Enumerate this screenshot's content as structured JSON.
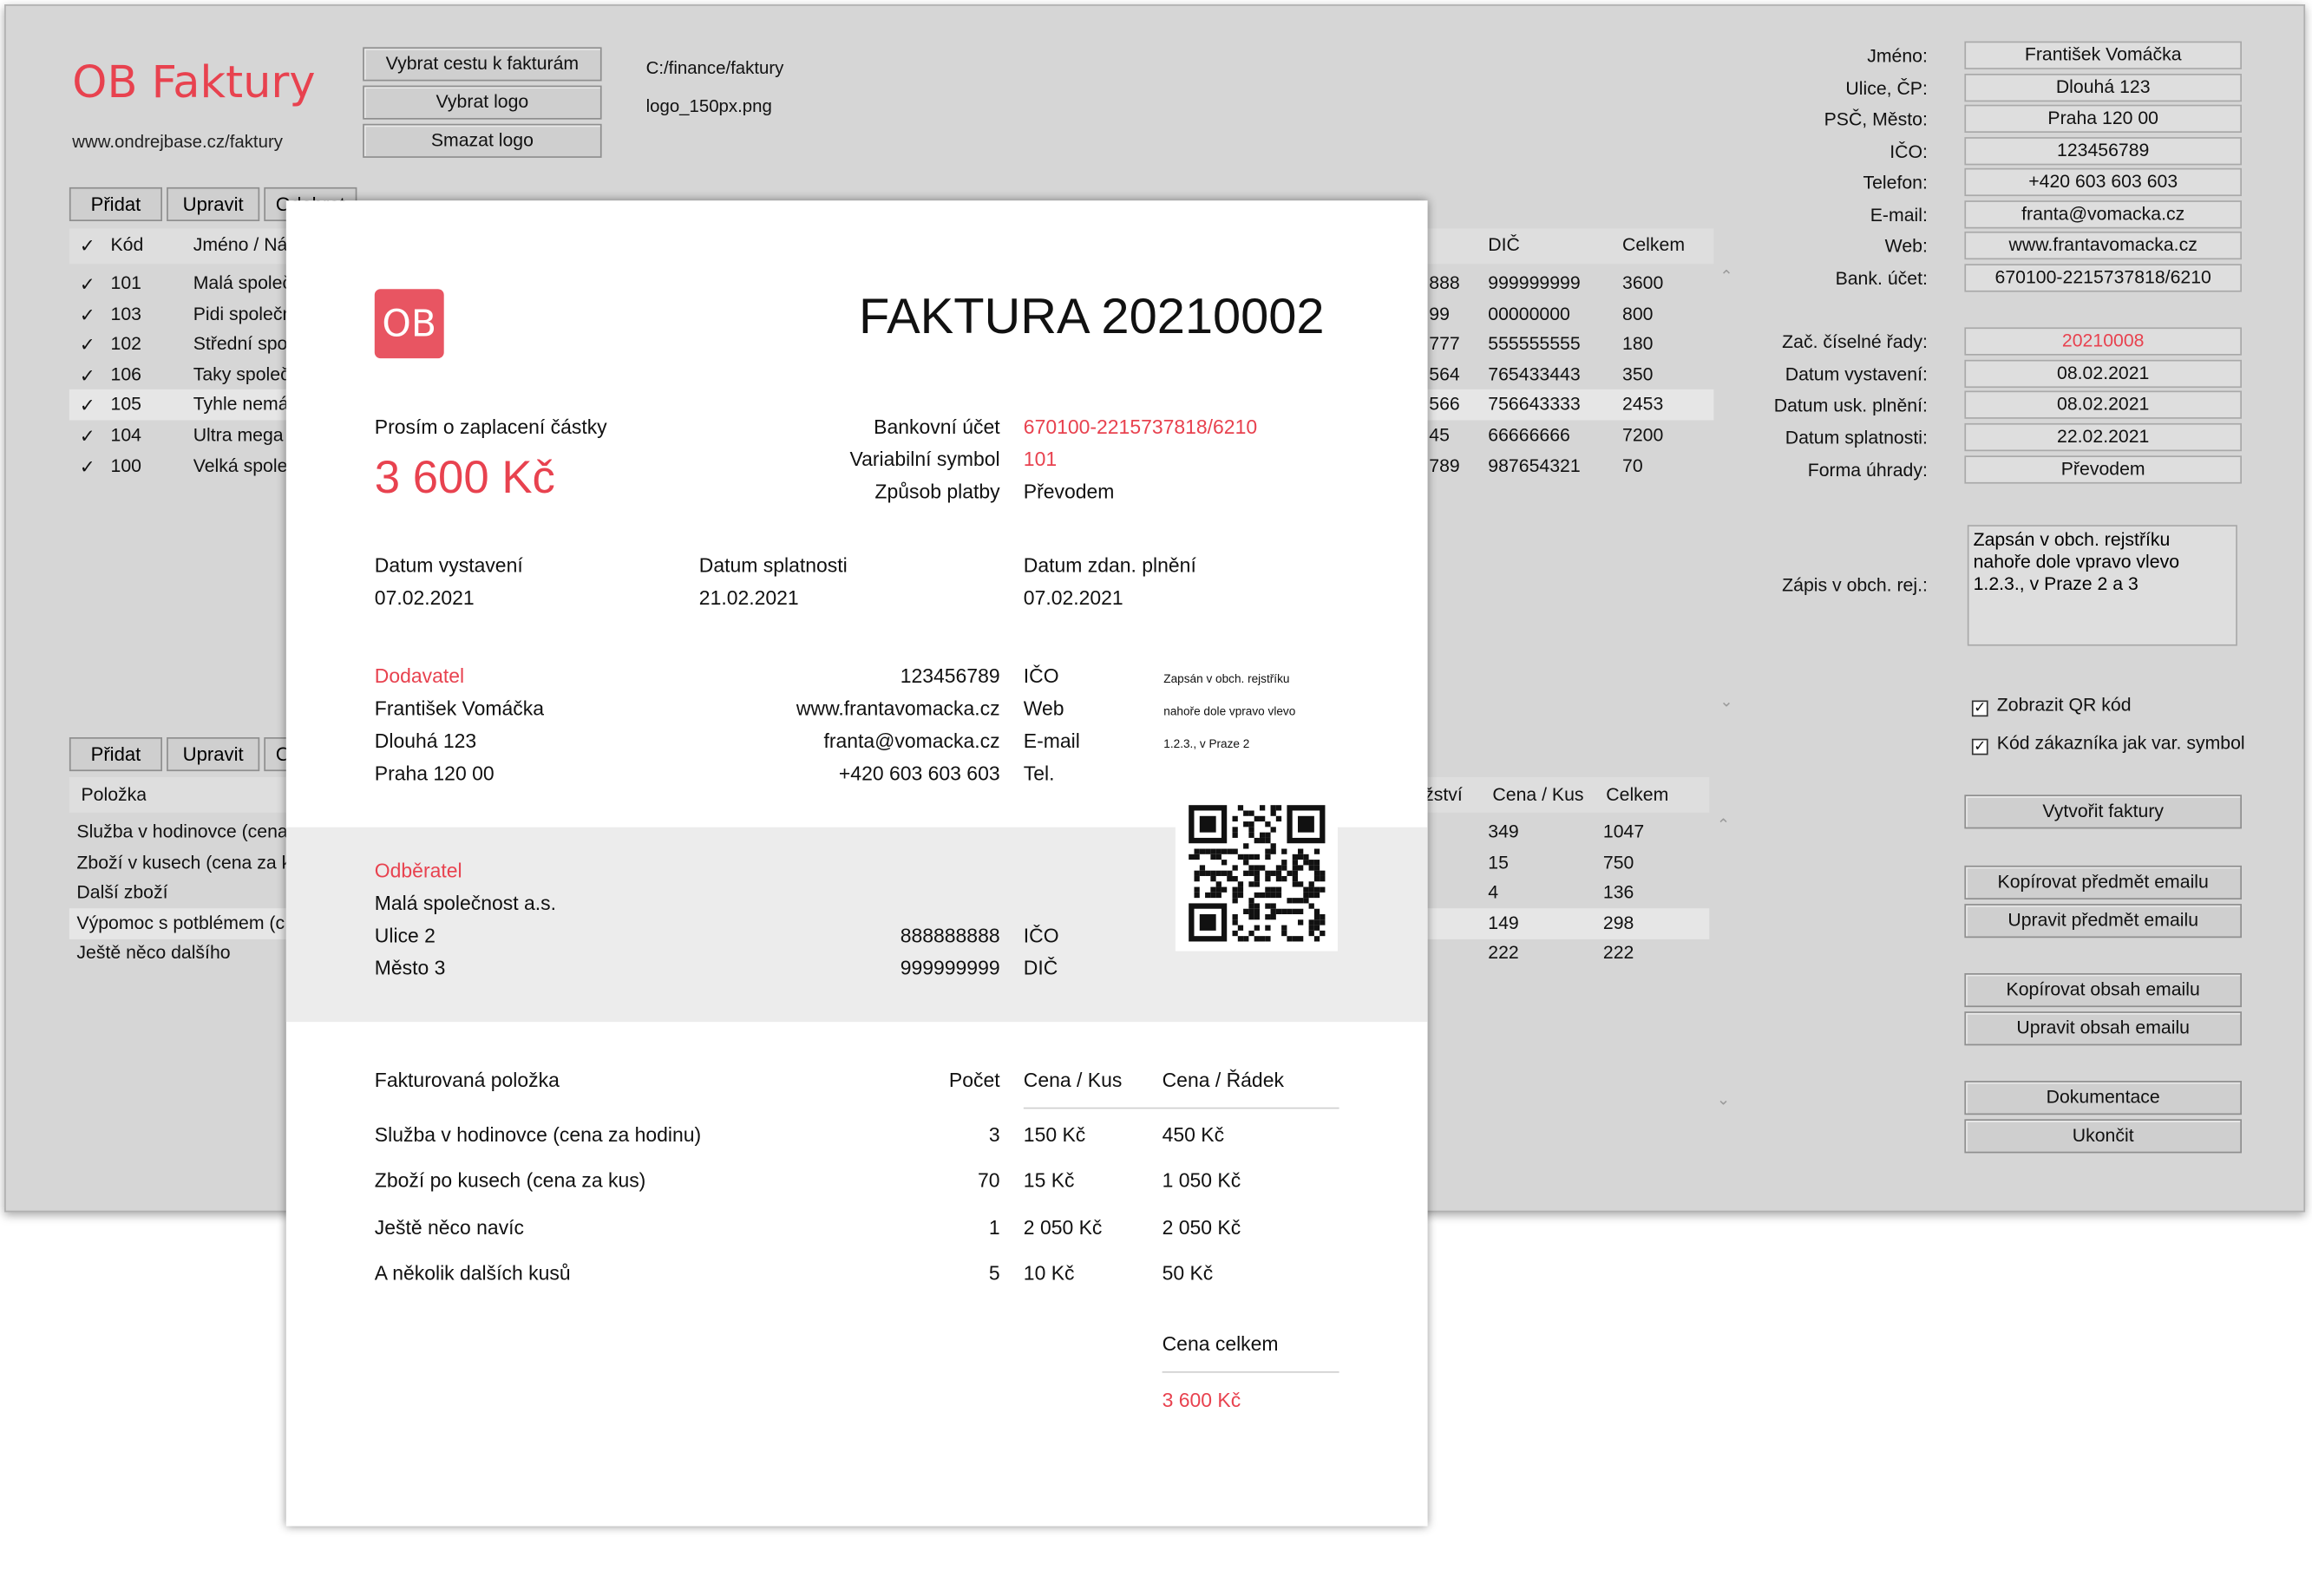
{
  "app": {
    "title": "OB Faktury",
    "url": "www.ondrejbase.cz/faktury",
    "buttons": {
      "choose_path": "Vybrat cestu k fakturám",
      "choose_logo": "Vybrat logo",
      "delete_logo": "Smazat logo"
    },
    "path_value": "C:/finance/faktury",
    "logo_value": "logo_150px.png"
  },
  "customers": {
    "toolbar": {
      "add": "Přidat",
      "edit": "Upravit",
      "delete": "Odebrat"
    },
    "columns": [
      "✓",
      "Kód",
      "Jméno / Ná",
      "DIČ",
      "Celkem"
    ],
    "rows": [
      {
        "check": "✓",
        "code": "101",
        "name": "Malá společ",
        "ico": "888",
        "dic": "999999999",
        "total": "3600"
      },
      {
        "check": "✓",
        "code": "103",
        "name": "Pidi společn",
        "ico": "99",
        "dic": "00000000",
        "total": "800"
      },
      {
        "check": "✓",
        "code": "102",
        "name": "Střední spol",
        "ico": "777",
        "dic": "555555555",
        "total": "180"
      },
      {
        "check": "✓",
        "code": "106",
        "name": "Taky společ",
        "ico": "564",
        "dic": "765433443",
        "total": "350"
      },
      {
        "check": "✓",
        "code": "105",
        "name": "Tyhle nemár",
        "ico": "566",
        "dic": "756643333",
        "total": "2453"
      },
      {
        "check": "✓",
        "code": "104",
        "name": "Ultra mega",
        "ico": "45",
        "dic": "66666666",
        "total": "7200"
      },
      {
        "check": "✓",
        "code": "100",
        "name": "Velká spole",
        "ico": "789",
        "dic": "987654321",
        "total": "70"
      }
    ]
  },
  "items": {
    "toolbar": {
      "add": "Přidat",
      "edit": "Upravit",
      "delete": "Odebrat"
    },
    "columns": [
      "Položka",
      "ožství",
      "Cena / Kus",
      "Celkem"
    ],
    "rows": [
      {
        "name": "Služba v hodinovce (cena za",
        "qty": "",
        "price": "349",
        "total": "1047"
      },
      {
        "name": "Zboží v kusech (cena za ku",
        "qty": "",
        "price": "15",
        "total": "750"
      },
      {
        "name": "Další zboží",
        "qty": "",
        "price": "4",
        "total": "136"
      },
      {
        "name": "Výpomoc s potblémem (c",
        "qty": "",
        "price": "149",
        "total": "298"
      },
      {
        "name": "Ještě něco dalšího",
        "qty": "",
        "price": "222",
        "total": "222"
      }
    ]
  },
  "supplier_form": {
    "name_label": "Jméno:",
    "name": "František Vomáčka",
    "street_label": "Ulice, ČP:",
    "street": "Dlouhá 123",
    "city_label": "PSČ, Město:",
    "city": "Praha 120 00",
    "ico_label": "IČO:",
    "ico": "123456789",
    "phone_label": "Telefon:",
    "phone": "+420 603 603 603",
    "email_label": "E-mail:",
    "email": "franta@vomacka.cz",
    "web_label": "Web:",
    "web": "www.frantavomacka.cz",
    "bank_label": "Bank. účet:",
    "bank": "670100-2215737818/6210",
    "series_label": "Zač. číselné řady:",
    "series": "20210008",
    "issued_label": "Datum vystavení:",
    "issued": "08.02.2021",
    "taxable_label": "Datum usk. plnění:",
    "taxable": "08.02.2021",
    "due_label": "Datum splatnosti:",
    "due": "22.02.2021",
    "payment_label": "Forma úhrady:",
    "payment": "Převodem",
    "register_label": "Zápis v obch. rej.:",
    "register": "Zapsán v obch. rejstříku nahoře dole vpravo vlevo 1.2.3., v Praze 2 a 3",
    "show_qr": "Zobrazit QR kód",
    "customer_code_vs": "Kód zákazníka jak var. symbol"
  },
  "actions": {
    "create_invoice": "Vytvořit faktury",
    "copy_subject": "Kopírovat předmět emailu",
    "edit_subject": "Upravit předmět emailu",
    "copy_body": "Kopírovat obsah emailu",
    "edit_body": "Upravit obsah emailu",
    "docs": "Dokumentace",
    "quit": "Ukončit"
  },
  "invoice": {
    "logo": "OB",
    "title": "FAKTURA 20210002",
    "pay_prompt": "Prosím o zaplacení částky",
    "amount": "3 600 Kč",
    "bank_label": "Bankovní účet",
    "bank": "670100-2215737818/6210",
    "vs_label": "Variabilní symbol",
    "vs": "101",
    "method_label": "Způsob platby",
    "method": "Převodem",
    "issued_label": "Datum vystavení",
    "issued": "07.02.2021",
    "due_label": "Datum splatnosti",
    "due": "21.02.2021",
    "taxable_label": "Datum zdan. plnění",
    "taxable": "07.02.2021",
    "supplier": {
      "heading": "Dodavatel",
      "name": "František Vomáčka",
      "street": "Dlouhá 123",
      "city": "Praha 120 00",
      "ico": "123456789",
      "ico_label": "IČO",
      "web": "www.frantavomacka.cz",
      "web_label": "Web",
      "email": "franta@vomacka.cz",
      "email_label": "E-mail",
      "phone": "+420 603 603 603",
      "phone_label": "Tel.",
      "register_1": "Zapsán v obch. rejstříku",
      "register_2": "nahoře dole vpravo vlevo",
      "register_3": "1.2.3., v Praze 2"
    },
    "customer": {
      "heading": "Odběratel",
      "name": "Malá společnost a.s.",
      "street": "Ulice 2",
      "city": "Město 3",
      "ico": "888888888",
      "ico_label": "IČO",
      "dic": "999999999",
      "dic_label": "DIČ"
    },
    "table": {
      "h_item": "Fakturovaná položka",
      "h_qty": "Počet",
      "h_price": "Cena / Kus",
      "h_row": "Cena / Řádek",
      "rows": [
        {
          "item": "Služba v hodinovce (cena za hodinu)",
          "qty": "3",
          "price": "150 Kč",
          "row": "450 Kč"
        },
        {
          "item": "Zboží po kusech (cena za kus)",
          "qty": "70",
          "price": "15 Kč",
          "row": "1 050 Kč"
        },
        {
          "item": "Ještě něco navíc",
          "qty": "1",
          "price": "2 050 Kč",
          "row": "2 050 Kč"
        },
        {
          "item": "A několik dalších kusů",
          "qty": "5",
          "price": "10 Kč",
          "row": "50 Kč"
        }
      ],
      "total_label": "Cena celkem",
      "total": "3 600 Kč"
    }
  }
}
